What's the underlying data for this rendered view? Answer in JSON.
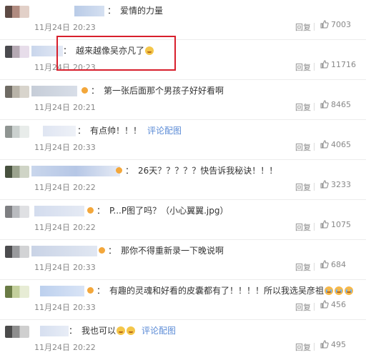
{
  "comments": [
    {
      "text": "爱情的力量",
      "date": "11月24日",
      "time": "20:23",
      "reply": "回复",
      "likes": "7003"
    },
    {
      "text": "越来越像吴亦凡了",
      "date": "11月24日",
      "time": "20:23",
      "reply": "回复",
      "likes": "11716"
    },
    {
      "text": "第一张后面那个男孩子好好看啊",
      "date": "11月24日",
      "time": "20:21",
      "reply": "回复",
      "likes": "8465"
    },
    {
      "text": "有点帅！！！",
      "link": "评论配图",
      "date": "11月24日",
      "time": "20:33",
      "reply": "回复",
      "likes": "4065"
    },
    {
      "text": "26天？？？？？快告诉我秘诀！！！",
      "date": "11月24日",
      "time": "20:22",
      "reply": "回复",
      "likes": "3233"
    },
    {
      "text": "P...P图了吗？（小心翼翼.jpg）",
      "date": "11月24日",
      "time": "20:22",
      "reply": "回复",
      "likes": "1075"
    },
    {
      "text": "那你不得重新录一下晚说啊",
      "date": "11月24日",
      "time": "20:33",
      "reply": "回复",
      "likes": "684"
    },
    {
      "text": "有趣的灵魂和好看的皮囊都有了！！！！所以我选吴彦祖",
      "date": "11月24日",
      "time": "20:33",
      "reply": "回复",
      "likes": "456"
    },
    {
      "text": "我也可以",
      "link": "评论配图",
      "date": "11月24日",
      "time": "20:22",
      "reply": "回复",
      "likes": "495"
    }
  ],
  "colon": "：",
  "colors": {
    "highlight": "#d81f2c",
    "link": "#5b8bd6",
    "meta": "#888888"
  }
}
